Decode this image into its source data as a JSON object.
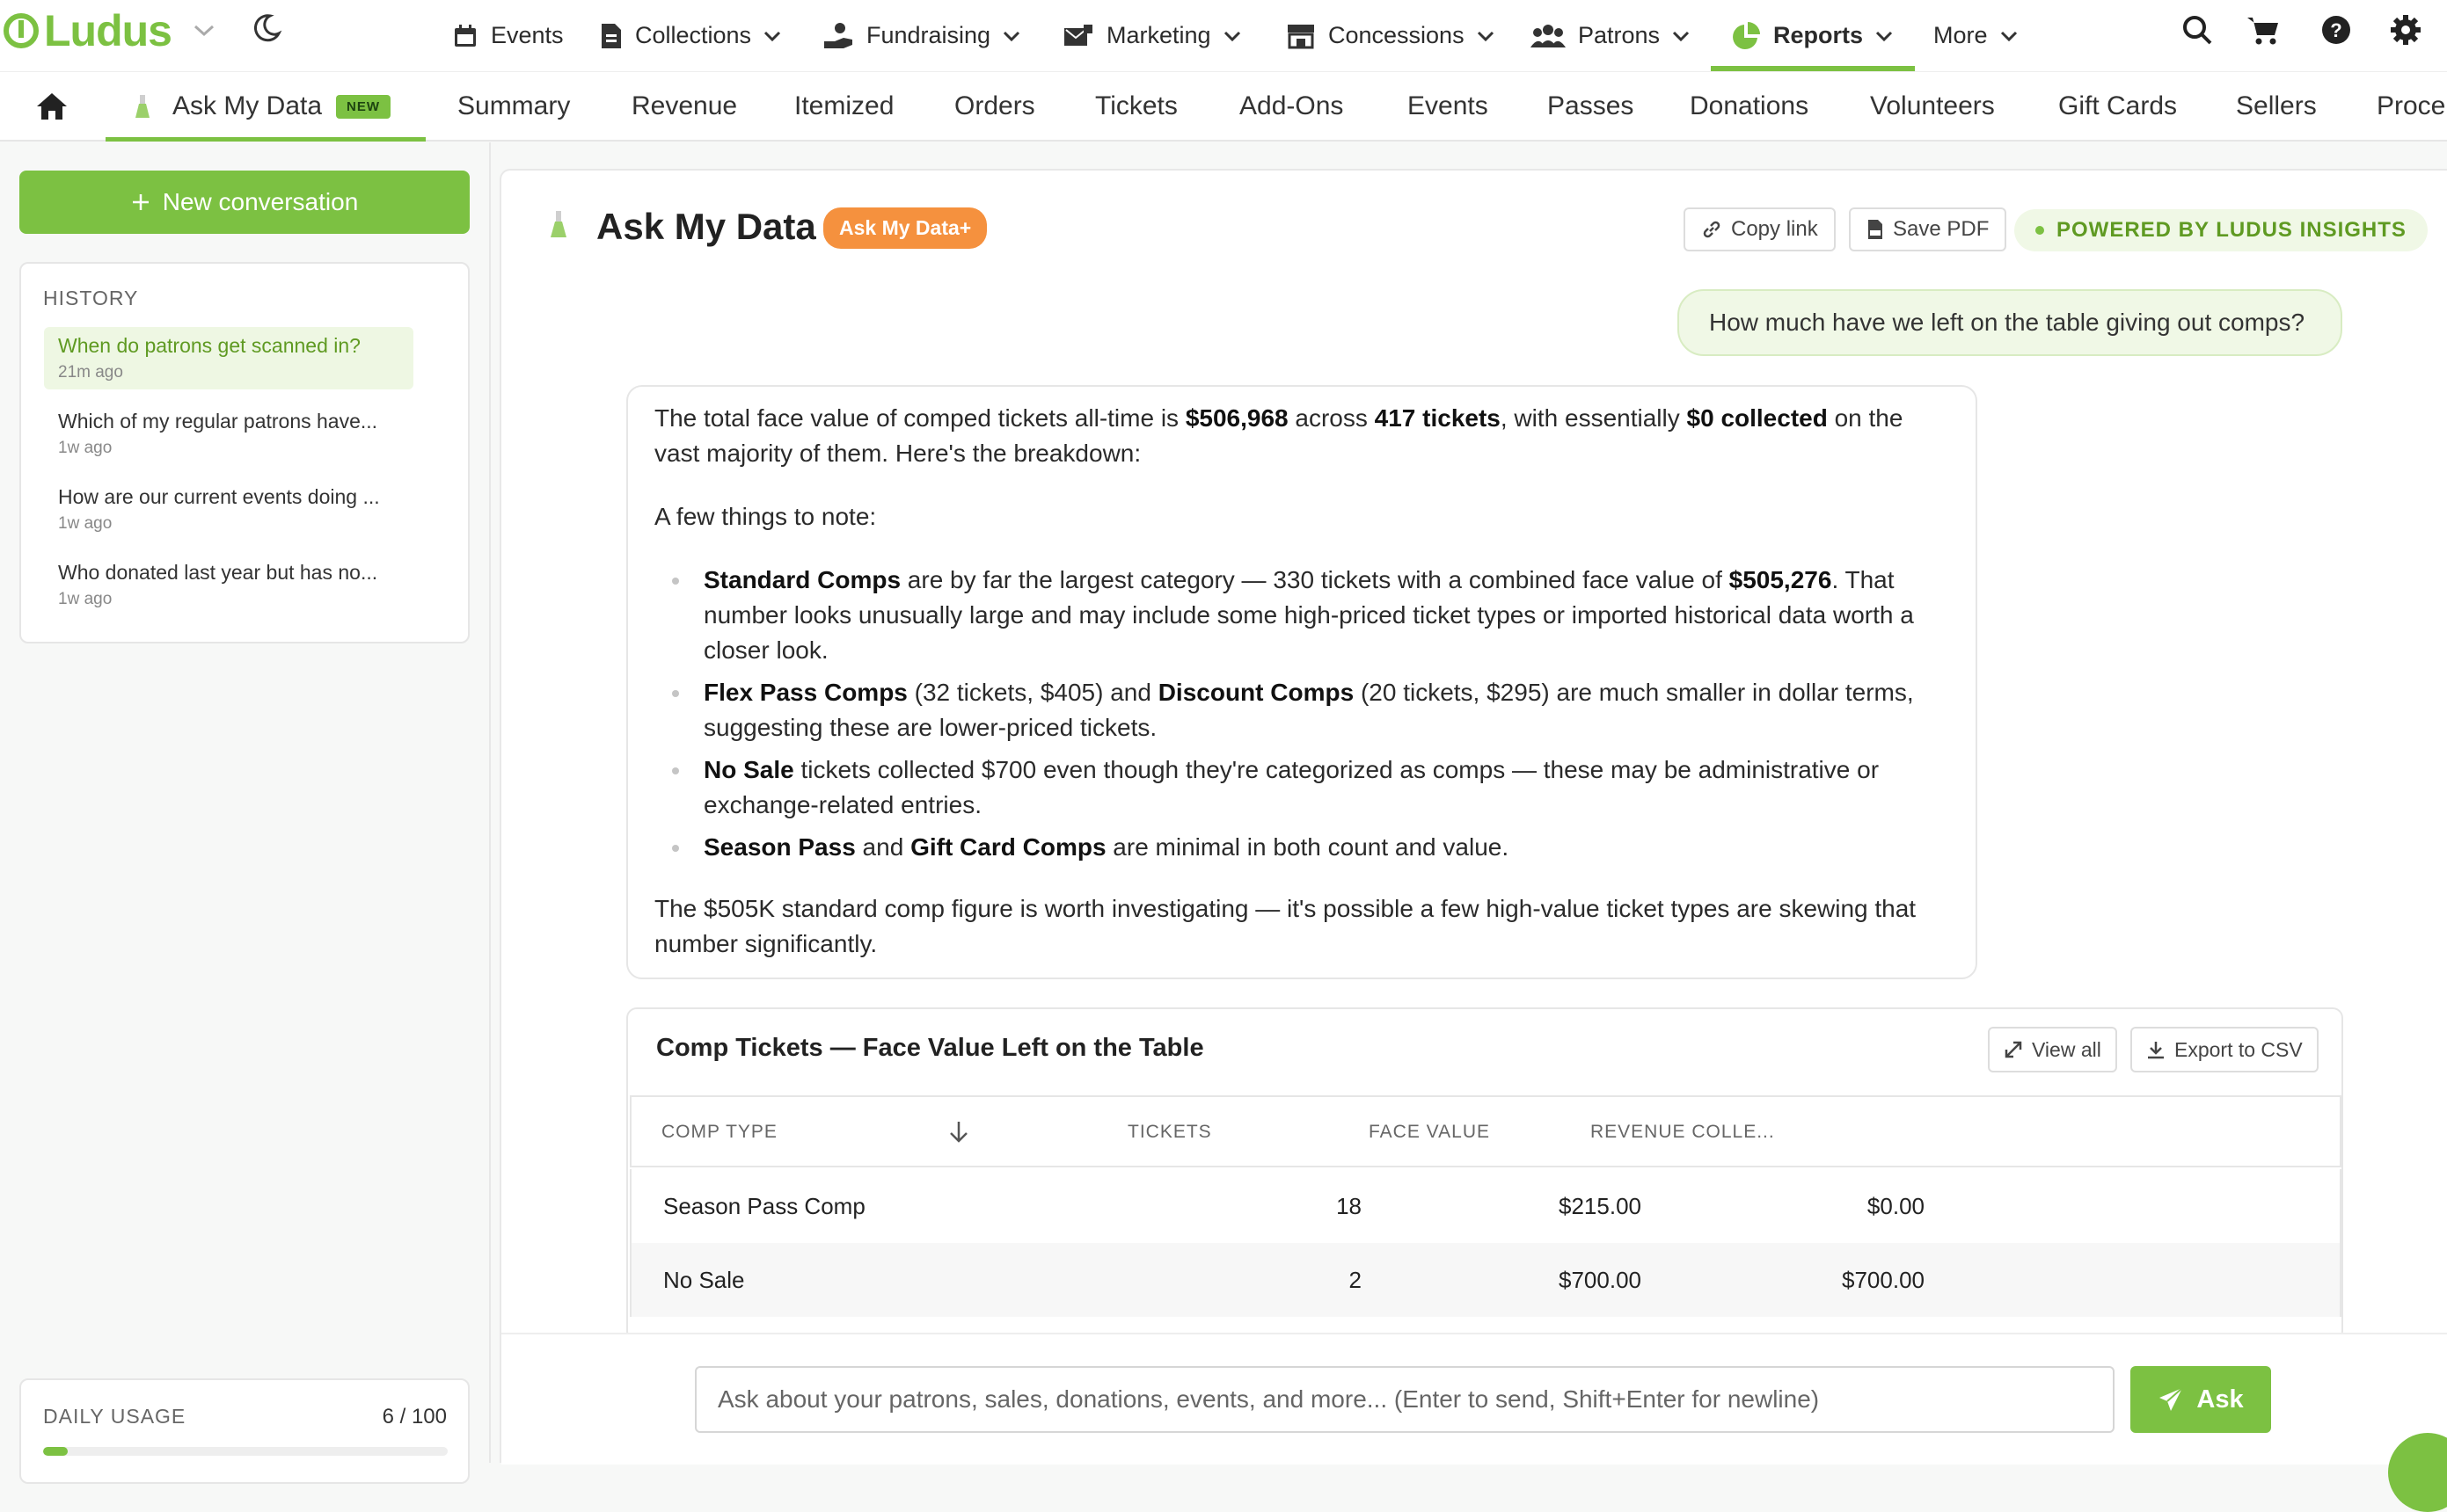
{
  "brand": {
    "name": "Ludus",
    "accent": "#7cc142",
    "orange": "#f5913e"
  },
  "topnav": {
    "items": [
      {
        "label": "Events",
        "icon": "calendar-icon"
      },
      {
        "label": "Collections",
        "icon": "document-icon"
      },
      {
        "label": "Fundraising",
        "icon": "hand-coins-icon"
      },
      {
        "label": "Marketing",
        "icon": "mail-icon"
      },
      {
        "label": "Concessions",
        "icon": "store-icon"
      },
      {
        "label": "Patrons",
        "icon": "people-icon"
      },
      {
        "label": "Reports",
        "icon": "pie-chart-icon"
      },
      {
        "label": "More",
        "icon": ""
      }
    ]
  },
  "subnav": {
    "tabs": [
      "Ask My Data",
      "Summary",
      "Revenue",
      "Itemized",
      "Orders",
      "Tickets",
      "Add-Ons",
      "Events",
      "Passes",
      "Donations",
      "Volunteers",
      "Gift Cards",
      "Sellers",
      "Proce"
    ],
    "new_badge": "NEW"
  },
  "sidebar": {
    "new_conversation": "New conversation",
    "history_title": "HISTORY",
    "history": [
      {
        "q": "When do patrons get scanned in?",
        "t": "21m ago"
      },
      {
        "q": "Which of my regular patrons have...",
        "t": "1w ago"
      },
      {
        "q": "How are our current events doing ...",
        "t": "1w ago"
      },
      {
        "q": "Who donated last year but has no...",
        "t": "1w ago"
      }
    ],
    "usage_label": "DAILY USAGE",
    "usage_count": "6 / 100",
    "usage_fraction": 0.06
  },
  "main": {
    "title": "Ask My Data",
    "plus_badge": "Ask My Data+",
    "copy_link": "Copy link",
    "save_pdf": "Save PDF",
    "powered": "POWERED BY LUDUS INSIGHTS",
    "user_question": "How much have we left on the table giving out comps?",
    "answer": {
      "p1_a": "The total face value of comped tickets all-time is ",
      "p1_b": "$506,968",
      "p1_c": " across ",
      "p1_d": "417 tickets",
      "p1_e": ", with essentially ",
      "p1_f": "$0 collected",
      "p1_g": " on the vast majority of them. Here's the breakdown:",
      "p2": "A few things to note:",
      "b1_a": "Standard Comps",
      "b1_b": " are by far the largest category — 330 tickets with a combined face value of ",
      "b1_c": "$505,276",
      "b1_d": ". That number looks unusually large and may include some high-priced ticket types or imported historical data worth a closer look.",
      "b2_a": "Flex Pass Comps",
      "b2_b": " (32 tickets, $405) and ",
      "b2_c": "Discount Comps",
      "b2_d": " (20 tickets, $295) are much smaller in dollar terms, suggesting these are lower-priced tickets.",
      "b3_a": "No Sale",
      "b3_b": " tickets collected $700 even though they're categorized as comps — these may be administrative or exchange-related entries.",
      "b4_a": "Season Pass",
      "b4_b": " and ",
      "b4_c": "Gift Card Comps",
      "b4_d": " are minimal in both count and value.",
      "p3": "The $505K standard comp figure is worth investigating — it's possible a few high-value ticket types are skewing that number significantly."
    },
    "table": {
      "title": "Comp Tickets — Face Value Left on the Table",
      "view_all": "View all",
      "export": "Export to CSV",
      "headers": [
        "COMP TYPE",
        "TICKETS",
        "FACE VALUE",
        "REVENUE COLLE..."
      ],
      "rows": [
        [
          "Season Pass Comp",
          "18",
          "$215.00",
          "$0.00"
        ],
        [
          "No Sale",
          "2",
          "$700.00",
          "$700.00"
        ]
      ]
    },
    "composer": {
      "placeholder": "Ask about your patrons, sales, donations, events, and more... (Enter to send, Shift+Enter for newline)",
      "ask": "Ask"
    }
  }
}
